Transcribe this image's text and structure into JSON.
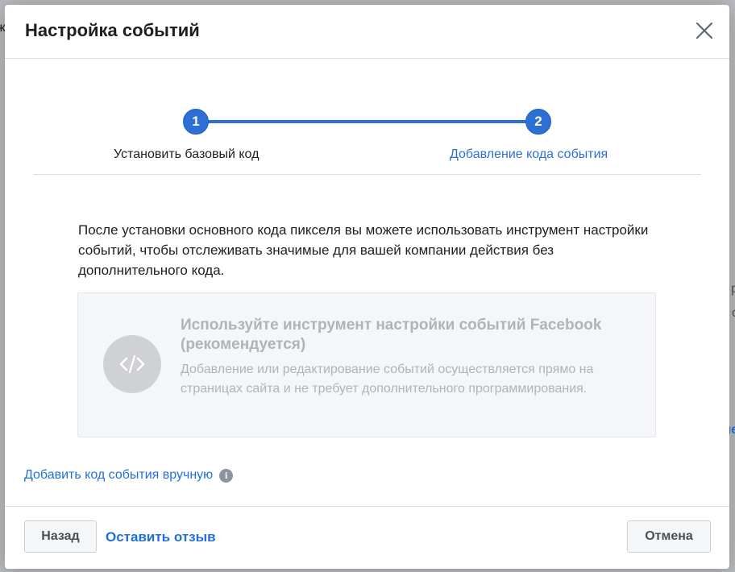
{
  "background": {
    "left_peek": "ж",
    "right_peek_1": "р",
    "right_peek_2": "с",
    "right_peek_3": "не"
  },
  "modal": {
    "title": "Настройка событий",
    "close_icon": "close-icon"
  },
  "stepper": {
    "steps": [
      {
        "number": "1",
        "label": "Установить базовый код",
        "state": "completed"
      },
      {
        "number": "2",
        "label": "Добавление кода события",
        "state": "active"
      }
    ],
    "accent_color": "#2e6fd6"
  },
  "content": {
    "intro": "После установки основного кода пикселя вы можете использовать инструмент настройки событий, чтобы отслеживать значимые для вашей компании действия без дополнительного кода.",
    "option": {
      "icon": "code-icon",
      "title": "Используйте инструмент настройки событий Facebook (рекомендуется)",
      "description": "Добавление или редактирование событий осуществляется прямо на страницах сайта и не требует дополнительного программирования.",
      "state": "disabled"
    },
    "manual_link": "Добавить код события вручную",
    "info_glyph": "i"
  },
  "footer": {
    "back_label": "Назад",
    "feedback_label": "Оставить отзыв",
    "cancel_label": "Отмена"
  }
}
